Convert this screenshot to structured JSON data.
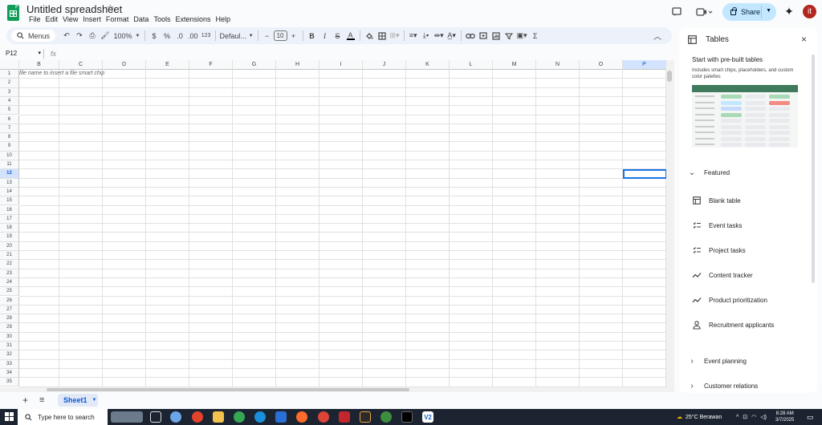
{
  "app": {
    "doc_title": "Untitled spreadsheet",
    "menus": [
      "File",
      "Edit",
      "View",
      "Insert",
      "Format",
      "Data",
      "Tools",
      "Extensions",
      "Help"
    ],
    "share_label": "Share",
    "avatar_letter": "it"
  },
  "toolbar": {
    "menus_label": "Menus",
    "zoom": "100%",
    "currency": "$",
    "percent": "%",
    "dec_decrease": ".0",
    "dec_increase": ".00",
    "number_format": "123",
    "font": "Defaul...",
    "font_size": "10",
    "minus": "−",
    "plus": "+",
    "bold": "B",
    "italic": "I",
    "strike": "S",
    "text_color": "A",
    "sigma": "Σ"
  },
  "formula_bar": {
    "name_box": "P12",
    "fx": "fx",
    "value": ""
  },
  "grid": {
    "columns": [
      "B",
      "C",
      "D",
      "E",
      "F",
      "G",
      "H",
      "I",
      "J",
      "K",
      "L",
      "M",
      "N",
      "O",
      "P"
    ],
    "selected_column": "P",
    "selected_row": "12",
    "rows": [
      "1",
      "2",
      "3",
      "4",
      "5",
      "6",
      "7",
      "8",
      "9",
      "10",
      "11",
      "12",
      "13",
      "14",
      "15",
      "16",
      "17",
      "18",
      "19",
      "20",
      "21",
      "22",
      "23",
      "24",
      "25",
      "26",
      "27",
      "28",
      "29",
      "30",
      "31",
      "32",
      "33",
      "34",
      "35"
    ],
    "a1_hint": "file name to insert a file smart chip"
  },
  "sheets": {
    "tabs": [
      {
        "label": "Sheet1"
      }
    ]
  },
  "panel": {
    "title": "Tables",
    "heading": "Start with pre-built tables",
    "description": "Includes smart chips, placeholders, and custom color palettes",
    "featured_label": "Featured",
    "featured_items": [
      {
        "label": "Blank table",
        "icon": "table-icon"
      },
      {
        "label": "Event tasks",
        "icon": "checklist-icon"
      },
      {
        "label": "Project tasks",
        "icon": "checklist-icon"
      },
      {
        "label": "Content tracker",
        "icon": "trend-icon"
      },
      {
        "label": "Product prioritization",
        "icon": "trend-icon"
      },
      {
        "label": "Recruitment applicants",
        "icon": "person-icon"
      }
    ],
    "groups": [
      {
        "label": "Event planning"
      },
      {
        "label": "Customer relations"
      }
    ]
  },
  "taskbar": {
    "search_placeholder": "Type here to search",
    "weather": "25°C  Berawan",
    "time": "8:28 AM",
    "date": "3/7/2025"
  },
  "colors": {
    "accent": "#0b57d0",
    "sheets_green": "#0f9d58",
    "share_bg": "#c2e7ff",
    "avatar": "#b3261e"
  }
}
